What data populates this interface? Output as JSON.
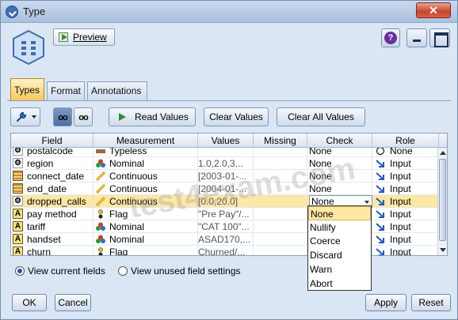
{
  "window": {
    "title": "Type",
    "close_glyph": "✕"
  },
  "header": {
    "preview_label": "Preview",
    "help_glyph": "?"
  },
  "tabs": [
    {
      "label": "Types",
      "active": true
    },
    {
      "label": "Format",
      "active": false
    },
    {
      "label": "Annotations",
      "active": false
    }
  ],
  "toolbar": {
    "glasses_glyph": "oo",
    "read_values": "Read Values",
    "clear_values": "Clear Values",
    "clear_all_values": "Clear All Values"
  },
  "table": {
    "columns": [
      "Field",
      "Measurement",
      "Values",
      "Missing",
      "Check",
      "Role"
    ],
    "rows": [
      {
        "field": "postalcode",
        "icon": "G",
        "measurement": "Typeless",
        "values": "",
        "missing": "",
        "check": "None",
        "role": "None"
      },
      {
        "field": "region",
        "icon": "G",
        "measurement": "Nominal",
        "values": "1.0,2.0,3...",
        "missing": "",
        "check": "None",
        "role": "Input"
      },
      {
        "field": "connect_date",
        "icon": "D",
        "measurement": "Continuous",
        "values": "[2003-01-...",
        "missing": "",
        "check": "None",
        "role": "Input"
      },
      {
        "field": "end_date",
        "icon": "D",
        "measurement": "Continuous",
        "values": "[2004-01-...",
        "missing": "",
        "check": "None",
        "role": "Input"
      },
      {
        "field": "dropped_calls",
        "icon": "G",
        "measurement": "Continuous",
        "values": "[0.0,20.0]",
        "missing": "",
        "check": "None",
        "role": "Input",
        "selected": true
      },
      {
        "field": "pay method",
        "icon": "A",
        "measurement": "Flag",
        "values": "\"Pre Pay\"/...",
        "missing": "",
        "check": "",
        "role": "Input"
      },
      {
        "field": "tariff",
        "icon": "A",
        "measurement": "Nominal",
        "values": "\"CAT 100\"...",
        "missing": "",
        "check": "",
        "role": "Input"
      },
      {
        "field": "handset",
        "icon": "A",
        "measurement": "Nominal",
        "values": "ASAD170,...",
        "missing": "",
        "check": "",
        "role": "Input"
      },
      {
        "field": "churn",
        "icon": "A",
        "measurement": "Flag",
        "values": "Churned/...",
        "missing": "",
        "check": "",
        "role": "Input"
      }
    ]
  },
  "check_dropdown": {
    "selected": "None",
    "options": [
      "None",
      "Nullify",
      "Coerce",
      "Discard",
      "Warn",
      "Abort"
    ]
  },
  "view_options": {
    "current": "View current fields",
    "unused": "View unused field settings"
  },
  "buttons": {
    "ok": "OK",
    "cancel": "Cancel",
    "apply": "Apply",
    "reset": "Reset"
  },
  "watermark": "test4exam.com",
  "colors": {
    "selected_row": "#ffe7a4",
    "active_tab": "#f4c85a",
    "window_bg": "#dbe6f4"
  }
}
